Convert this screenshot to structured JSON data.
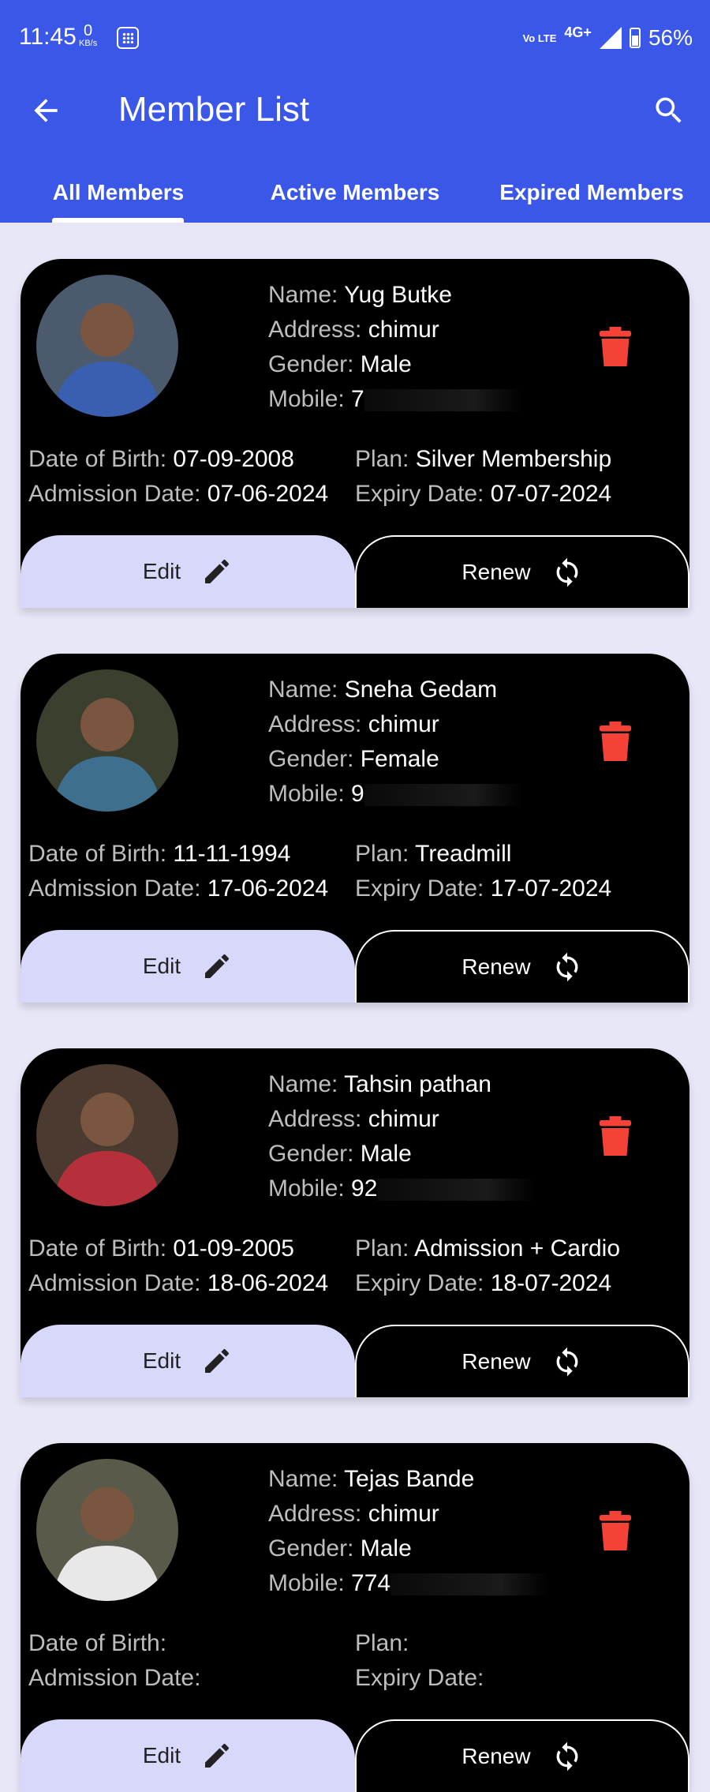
{
  "status_bar": {
    "time": "11:45",
    "speed_value": "0",
    "speed_unit": "KB/s",
    "net_volte": "Vo LTE",
    "net_type": "4G+",
    "battery": "56%"
  },
  "app_bar": {
    "title": "Member List"
  },
  "tabs": [
    {
      "label": "All Members",
      "active": true
    },
    {
      "label": "Active Members",
      "active": false
    },
    {
      "label": "Expired Members",
      "active": false
    }
  ],
  "labels": {
    "name": "Name: ",
    "address": "Address: ",
    "gender": "Gender: ",
    "mobile": "Mobile: ",
    "dob": "Date of Birth: ",
    "admission": "Admission Date: ",
    "plan": "Plan: ",
    "expiry": "Expiry Date: ",
    "edit": "Edit",
    "renew": "Renew"
  },
  "members": [
    {
      "name": "Yug Butke",
      "address": "chimur",
      "gender": "Male",
      "mobile": "7",
      "dob": "07-09-2008",
      "admission": "07-06-2024",
      "plan": "Silver Membership",
      "expiry": "07-07-2024"
    },
    {
      "name": "Sneha Gedam",
      "address": "chimur",
      "gender": "Female",
      "mobile": "9",
      "dob": "11-11-1994",
      "admission": "17-06-2024",
      "plan": "Treadmill",
      "expiry": "17-07-2024"
    },
    {
      "name": "Tahsin pathan",
      "address": "chimur",
      "gender": "Male",
      "mobile": "92",
      "dob": "01-09-2005",
      "admission": "18-06-2024",
      "plan": "Admission + Cardio",
      "expiry": "18-07-2024"
    },
    {
      "name": "Tejas Bande",
      "address": "chimur",
      "gender": "Male",
      "mobile": "774"
    }
  ],
  "colors": {
    "primary": "#3a57e8",
    "background": "#e7e7f8",
    "card": "#000000",
    "delete": "#f44336",
    "edit_button": "#d8d8fb"
  },
  "icons": {
    "back": "arrow-left-icon",
    "search": "search-icon",
    "delete": "trash-icon",
    "edit": "pencil-icon",
    "renew": "refresh-icon"
  }
}
